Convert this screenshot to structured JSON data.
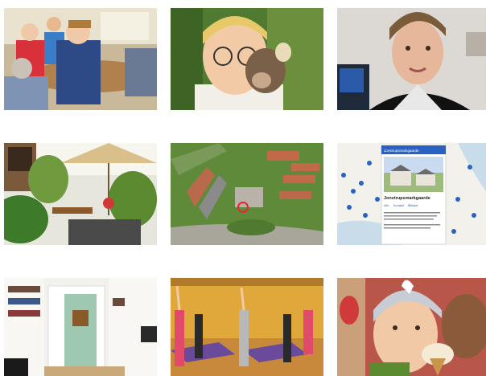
{
  "gallery": {
    "tiles": [
      {
        "id": "tile-1",
        "icon": "photo-children-playing-games"
      },
      {
        "id": "tile-2",
        "icon": "photo-boy-with-hedgehog"
      },
      {
        "id": "tile-3",
        "icon": "photo-young-man-portrait"
      },
      {
        "id": "tile-4",
        "icon": "photo-conservatory-plants"
      },
      {
        "id": "tile-5",
        "icon": "photo-aerial-campus"
      },
      {
        "id": "tile-6",
        "icon": "map-screenshot"
      },
      {
        "id": "tile-7",
        "icon": "photo-white-bookshelf-room"
      },
      {
        "id": "tile-8",
        "icon": "photo-yoga-class"
      },
      {
        "id": "tile-9",
        "icon": "photo-girl-with-ice-cream"
      }
    ]
  },
  "map_card": {
    "header": "Jonstrupsmarkgaarde",
    "title": "Jonstrupsmarkgaarde",
    "tab_1": "Info",
    "tab_2": "Kontakt",
    "tab_3": "Billeder"
  }
}
